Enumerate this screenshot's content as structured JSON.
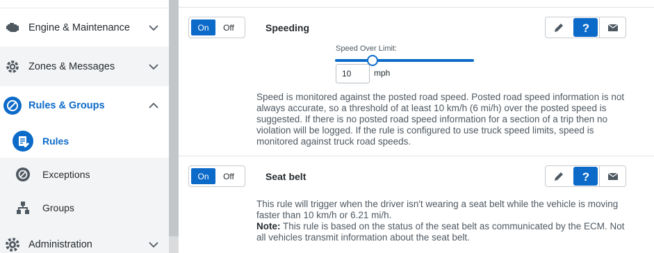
{
  "sidebar": {
    "items": [
      {
        "label": "Engine & Maintenance"
      },
      {
        "label": "Zones & Messages"
      },
      {
        "label": "Rules & Groups"
      },
      {
        "label": "Administration"
      }
    ],
    "subitems": [
      {
        "label": "Rules"
      },
      {
        "label": "Exceptions"
      },
      {
        "label": "Groups"
      }
    ]
  },
  "rules": [
    {
      "on_label": "On",
      "off_label": "Off",
      "title": "Speeding",
      "slider_label": "Speed Over Limit:",
      "slider_value": 0.27,
      "speed_value": "10",
      "speed_unit": "mph",
      "description": "Speed is monitored against the posted road speed. Posted road speed information is not always accurate, so a threshold of at least 10 km/h (6 mi/h) over the posted speed is suggested. If there is no posted road speed information for a section of a trip then no violation will be logged. If the rule is configured to use truck speed limits, speed is monitored against truck road speeds."
    },
    {
      "on_label": "On",
      "off_label": "Off",
      "title": "Seat belt",
      "description": "This rule will trigger when the driver isn't wearing a seat belt while the vehicle is moving faster than 10 km/h or 6.21 mi/h.",
      "note_label": "Note:",
      "note_text": " This rule is based on the status of the seat belt as communicated by the ECM. Not all vehicles transmit information about the seat belt."
    }
  ],
  "icons": {
    "edit": "pencil-icon",
    "help": "question-icon",
    "email": "envelope-icon"
  },
  "colors": {
    "accent": "#0c6ac9",
    "sidebar_bg": "#f3f4f5",
    "text": "#252a2e",
    "muted": "#4e5861"
  }
}
